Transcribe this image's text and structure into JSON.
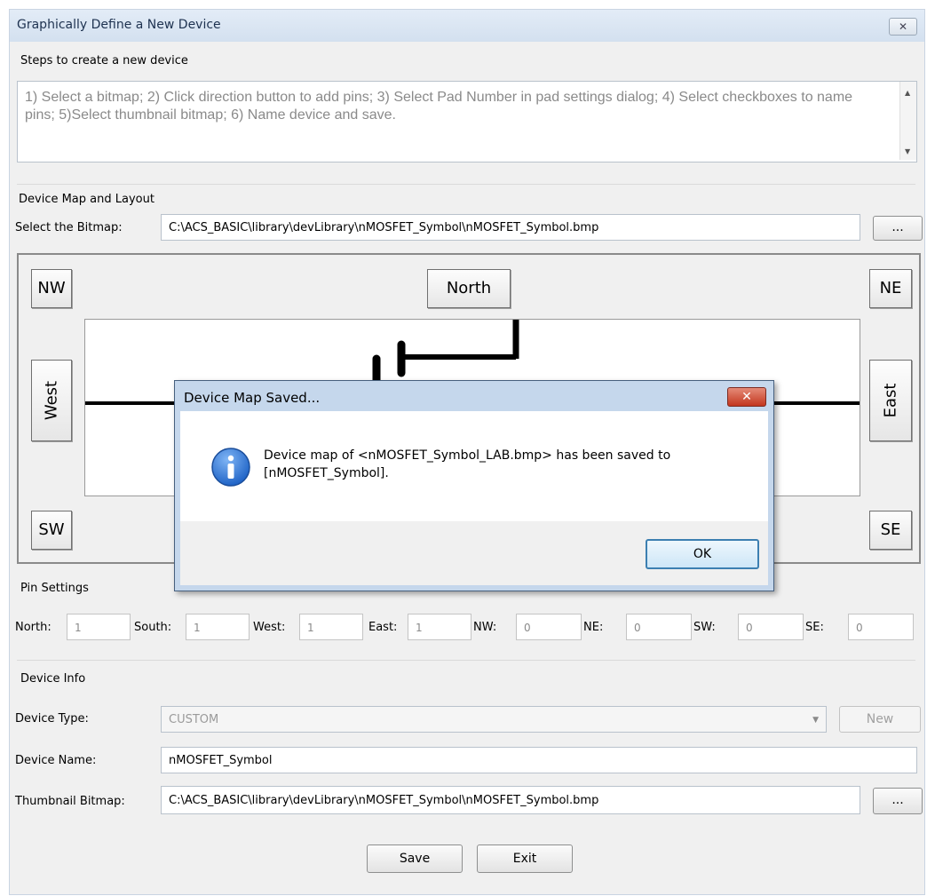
{
  "window": {
    "title": "Graphically Define a New Device",
    "close_glyph": "✕"
  },
  "steps": {
    "heading": "Steps to create a new device",
    "text": "1) Select a bitmap; 2) Click direction button to add pins; 3) Select Pad Number in pad settings dialog; 4) Select checkboxes to name pins; 5)Select thumbnail bitmap; 6) Name device and save."
  },
  "map": {
    "heading": "Device Map and Layout",
    "select_label": "Select the Bitmap:",
    "bitmap_path": "C:\\ACS_BASIC\\library\\devLibrary\\nMOSFET_Symbol\\nMOSFET_Symbol.bmp",
    "browse_label": "...",
    "directions": {
      "nw": "NW",
      "north": "North",
      "ne": "NE",
      "west": "West",
      "east": "East",
      "sw": "SW",
      "se": "SE"
    }
  },
  "pins": {
    "heading": "Pin Settings",
    "fields": [
      {
        "label": "North:",
        "value": "1"
      },
      {
        "label": "South:",
        "value": "1"
      },
      {
        "label": "West:",
        "value": "1"
      },
      {
        "label": "East:",
        "value": "1"
      },
      {
        "label": "NW:",
        "value": "0"
      },
      {
        "label": "NE:",
        "value": "0"
      },
      {
        "label": "SW:",
        "value": "0"
      },
      {
        "label": "SE:",
        "value": "0"
      }
    ]
  },
  "info": {
    "heading": "Device Info",
    "type_label": "Device Type:",
    "type_value": "CUSTOM",
    "new_label": "New",
    "name_label": "Device Name:",
    "name_value": "nMOSFET_Symbol",
    "thumb_label": "Thumbnail Bitmap:",
    "thumb_path": "C:\\ACS_BASIC\\library\\devLibrary\\nMOSFET_Symbol\\nMOSFET_Symbol.bmp",
    "browse_label": "..."
  },
  "actions": {
    "save": "Save",
    "exit": "Exit"
  },
  "dialog": {
    "title": "Device Map Saved...",
    "close_glyph": "✕",
    "message_line1": "Device map of <nMOSFET_Symbol_LAB.bmp> has been saved to",
    "message_line2": "[nMOSFET_Symbol].",
    "ok": "OK",
    "icon": "info-icon"
  },
  "colors": {
    "dialog_frame": "#c5d7ec",
    "info_blue": "#1f63c6",
    "close_red": "#c3361e",
    "ok_border": "#3c7fb1"
  }
}
